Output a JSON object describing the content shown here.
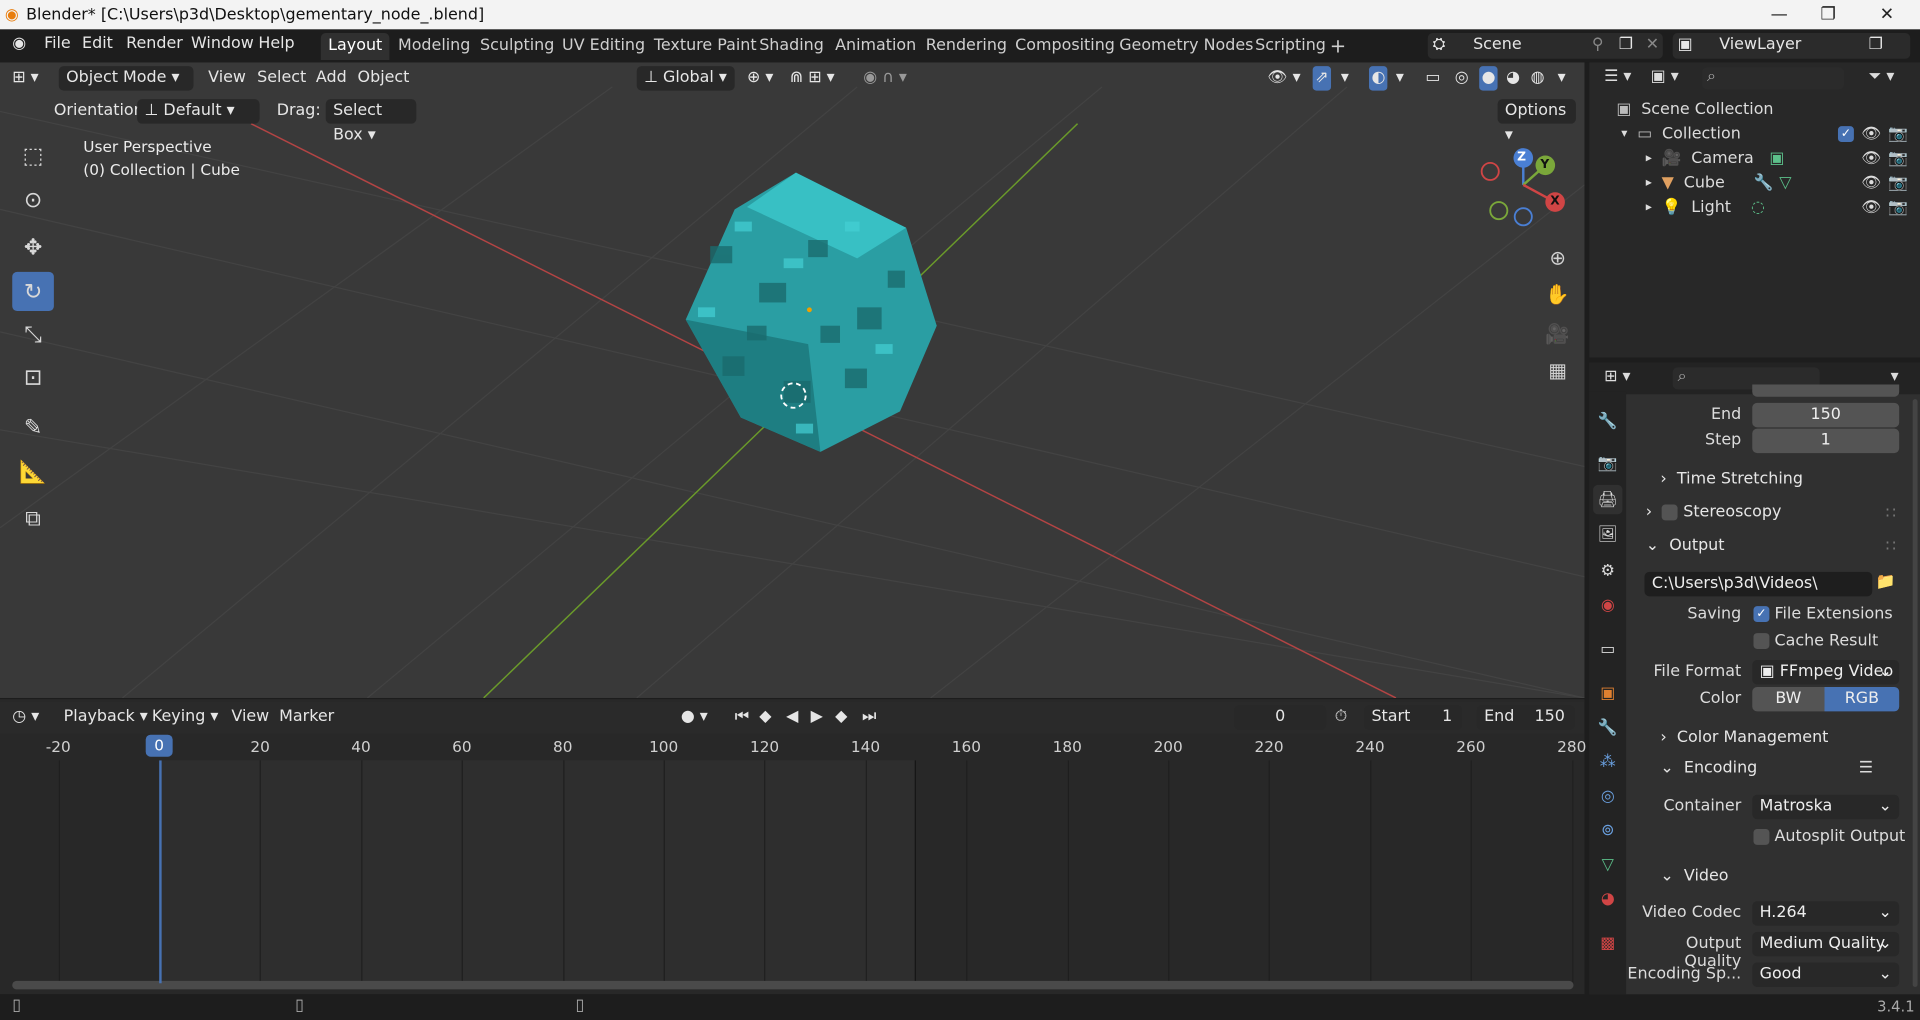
{
  "window": {
    "title": "Blender* [C:\\Users\\p3d\\Desktop\\gementary_node_.blend]",
    "minimize": "—",
    "maximize": "❐",
    "close": "✕"
  },
  "menu": {
    "file": "File",
    "edit": "Edit",
    "render": "Render",
    "window": "Window",
    "help": "Help"
  },
  "workspaces": [
    "Layout",
    "Modeling",
    "Sculpting",
    "UV Editing",
    "Texture Paint",
    "Shading",
    "Animation",
    "Rendering",
    "Compositing",
    "Geometry Nodes",
    "Scripting"
  ],
  "scene": {
    "name": "Scene",
    "view_layer": "ViewLayer"
  },
  "viewport": {
    "mode": "Object Mode",
    "menus": {
      "view": "View",
      "select": "Select",
      "add": "Add",
      "object": "Object"
    },
    "transform": "Global",
    "orientation_label": "Orientation:",
    "orientation": "Default",
    "drag_label": "Drag:",
    "drag": "Select Box",
    "options": "Options",
    "perspective": "User Perspective",
    "context": "(0) Collection | Cube",
    "gizmo": {
      "z": "Z",
      "y": "Y",
      "x": "X"
    }
  },
  "timeline": {
    "menus": {
      "playback": "Playback",
      "keying": "Keying",
      "view": "View",
      "marker": "Marker"
    },
    "current_frame": "0",
    "start_label": "Start",
    "start": "1",
    "end_label": "End",
    "end": "150",
    "ticks": [
      "-20",
      "0",
      "20",
      "40",
      "60",
      "80",
      "100",
      "120",
      "140",
      "160",
      "180",
      "200",
      "220",
      "240",
      "260",
      "280"
    ]
  },
  "outliner": {
    "scene_collection": "Scene Collection",
    "collection": "Collection",
    "items": [
      "Camera",
      "Cube",
      "Light"
    ]
  },
  "properties": {
    "frame_end_label": "End",
    "frame_end": "150",
    "frame_step_label": "Step",
    "frame_step": "1",
    "time_stretching": "Time Stretching",
    "stereoscopy": "Stereoscopy",
    "output": "Output",
    "output_path": "C:\\Users\\p3d\\Videos\\",
    "saving_label": "Saving",
    "file_extensions": "File Extensions",
    "cache_result": "Cache Result",
    "file_format_label": "File Format",
    "file_format": "FFmpeg Video",
    "color_label": "Color",
    "color_bw": "BW",
    "color_rgb": "RGB",
    "color_management": "Color Management",
    "encoding": "Encoding",
    "container_label": "Container",
    "container": "Matroska",
    "autosplit": "Autosplit Output",
    "video": "Video",
    "video_codec_label": "Video Codec",
    "video_codec": "H.264",
    "output_quality_label": "Output Quality",
    "output_quality": "Medium Quality",
    "encoding_speed_label": "Encoding Sp...",
    "encoding_speed": "Good"
  },
  "status": {
    "version": "3.4.1"
  },
  "colors": {
    "accent": "#4772b3",
    "cube": "#2aa3a8",
    "x_axis": "#b34444",
    "y_axis": "#6a9a2a"
  }
}
